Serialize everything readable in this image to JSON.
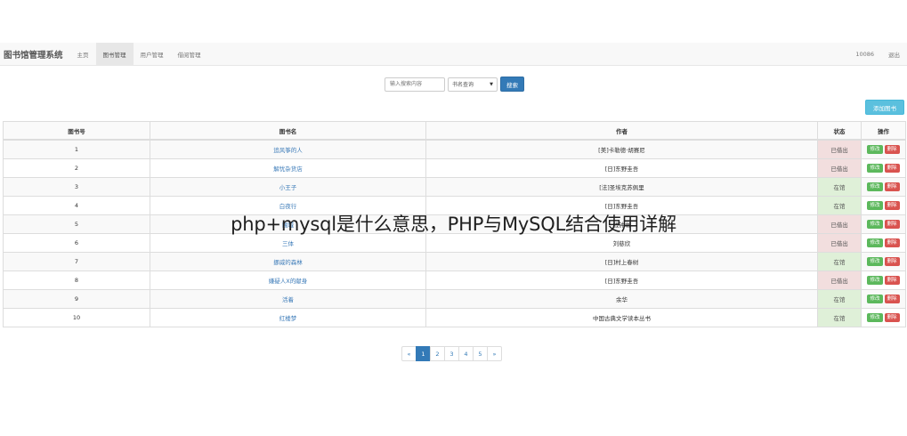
{
  "navbar": {
    "brand": "图书馆管理系统",
    "items": [
      {
        "label": "主页",
        "active": false
      },
      {
        "label": "图书管理",
        "active": true
      },
      {
        "label": "用户管理",
        "active": false
      },
      {
        "label": "借阅管理",
        "active": false
      }
    ],
    "user": "10086",
    "logout": "退出"
  },
  "search": {
    "placeholder": "输入搜索内容",
    "select_value": "书名查询",
    "button": "搜索"
  },
  "add_button": "添加图书",
  "table": {
    "headers": [
      "图书号",
      "图书名",
      "作者",
      "状态",
      "操作"
    ],
    "edit_label": "修改",
    "delete_label": "删除",
    "rows": [
      {
        "id": "1",
        "title": "追风筝的人",
        "author": "[美]卡勒德·胡赛尼",
        "status": "已借出"
      },
      {
        "id": "2",
        "title": "解忧杂货店",
        "author": "[日]东野圭吾",
        "status": "已借出"
      },
      {
        "id": "3",
        "title": "小王子",
        "author": "[法]圣埃克苏佩里",
        "status": "在馆"
      },
      {
        "id": "4",
        "title": "白夜行",
        "author": "[日]东野圭吾",
        "status": "在馆"
      },
      {
        "id": "5",
        "title": "围城",
        "author": "钱钟书",
        "status": "已借出"
      },
      {
        "id": "6",
        "title": "三体",
        "author": "刘慈欣",
        "status": "已借出"
      },
      {
        "id": "7",
        "title": "挪威的森林",
        "author": "[日]村上春树",
        "status": "在馆"
      },
      {
        "id": "8",
        "title": "嫌疑人X的献身",
        "author": "[日]东野圭吾",
        "status": "已借出"
      },
      {
        "id": "9",
        "title": "活着",
        "author": "余华",
        "status": "在馆"
      },
      {
        "id": "10",
        "title": "红楼梦",
        "author": "中国古典文学读本丛书",
        "status": "在馆"
      }
    ]
  },
  "pagination": {
    "prev": "«",
    "pages": [
      "1",
      "2",
      "3",
      "4",
      "5"
    ],
    "active": "1",
    "next": "»"
  },
  "overlay_caption": "php+mysql是什么意思，PHP与MySQL结合使用详解",
  "colors": {
    "primary": "#337ab7",
    "info": "#5bc0de",
    "success": "#5cb85c",
    "danger": "#d9534f",
    "status_out_bg": "#f2dede",
    "status_in_bg": "#dff0d8"
  }
}
